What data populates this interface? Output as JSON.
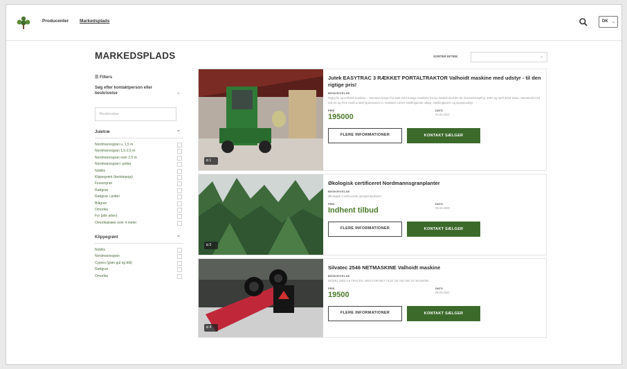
{
  "nav": {
    "producers": "Producenter",
    "marketplace": "Markedsplads",
    "language": "DK"
  },
  "page": {
    "title": "MARKEDSPLADS"
  },
  "sidebar": {
    "filters": "☰ Filters",
    "search_label": "Søg efter kontaktperson eller beskrivelse",
    "search_placeholder": "Beskrivelse",
    "section1": {
      "title": "Juletræ",
      "items": [
        "Nordmannsgran u. 1,5 m",
        "Nordmannsgran 1,5-2,5 m",
        "Nordmannsgran over 2,5 m",
        "Nordmannsgran i potter",
        "Nobilis",
        "Klippegrønt (bedstepoja)",
        "Fessergran",
        "Rødgran",
        "Rødgran i potter",
        "Blågran",
        "Omorika",
        "Fyr (pile arten)",
        "Omorikatræer over 4 meter"
      ]
    },
    "section2": {
      "title": "Klippegrønt",
      "items": [
        "Nobilis",
        "Nordmannsgran",
        "Cypres (grøn gul og blå)",
        "Rødgran",
        "Omorika"
      ]
    }
  },
  "sort": {
    "label": "SORTER EFTER:"
  },
  "listings": [
    {
      "title": "Jutek EASYTRAC 3 RÆKKET PORTALTRAKTOR Valhoidt maskine med udstyr - til den rigtige pris!",
      "desc_label": "BESKRIVELSE",
      "description": "Rigtig fin og velholdt maskine – Sammen bruger fra start med mange maskiner fra op. Modelt med 80 HK (Kassel/Jespeng. 2003 og April 2018 Solve. Sammenlt med red ulv ug Pine Hash & Mek hjulmotoren m. maskiner LEGIT Meltfolgende udstyr. Stellringbarrer og sprøjteudstyr.",
      "price_label": "PRIS",
      "price": "195000",
      "date_label": "DATO",
      "date": "04.03.2021",
      "photos": "1",
      "more_info": "FLERE INFORMATIONER",
      "contact": "KONTAKT SÆLGER"
    },
    {
      "title": "Økologisk certificeret Nordmannsgranplanter",
      "desc_label": "BESKRIVELSE",
      "description": "Økologisk Certificerede granplanteplanter.",
      "price_label": "PRIS",
      "price": "Indhent tilbud",
      "date_label": "DATO",
      "date": "09.03.2020",
      "photos": "3",
      "more_info": "FLERE INFORMATIONER",
      "contact": "KONTAKT SÆLGER"
    },
    {
      "title": "Silvatec 2546 NETMASKINE Valhoidt maskine",
      "desc_label": "BESKRIVELSE",
      "description": "MODEL 2602 2.0 TRACPS. SNIG FOR NET. PLDT SE VEJ NSI DT MASKINE",
      "price_label": "PRIS",
      "price": "19500",
      "date_label": "DATO",
      "date": "09.03.2021",
      "photos": "4",
      "more_info": "FLERE INFORMATIONER",
      "contact": "KONTAKT SÆLGER"
    }
  ],
  "icons": {
    "logo": "tree-logo-icon",
    "search": "search-icon",
    "camera": "camera-icon",
    "chevron": "chevron-down-icon"
  },
  "colors": {
    "brand_green": "#3c6a2b",
    "price_green": "#4b7a2a",
    "link_green": "#4a6d3a"
  }
}
